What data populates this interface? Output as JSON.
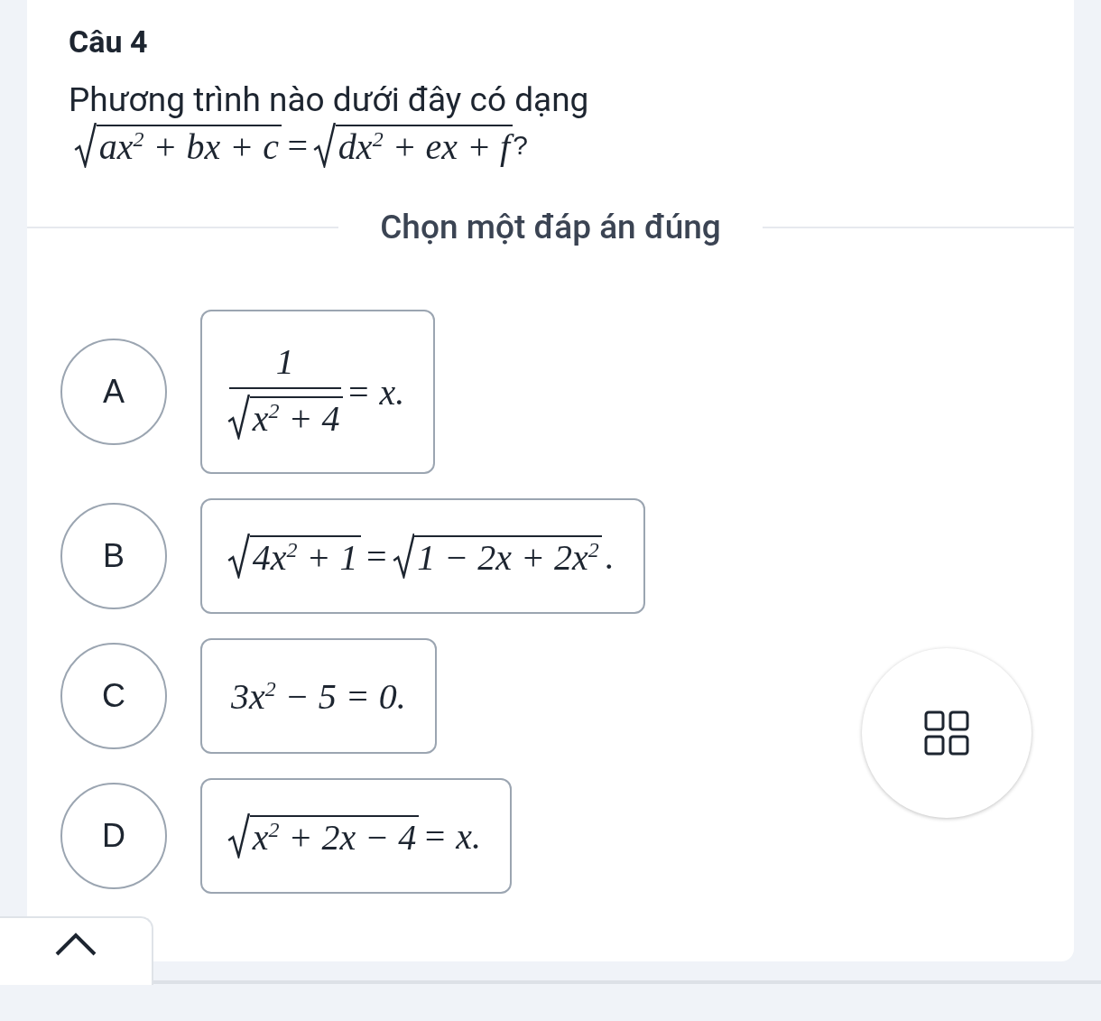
{
  "title": "Câu 4",
  "question": {
    "text": "Phương trình nào dưới đây có dạng",
    "formula": [
      {
        "kind": "sqrt",
        "text": "ax$^{2}$ + bx + c"
      },
      {
        "kind": "text",
        "text": "="
      },
      {
        "kind": "sqrt",
        "text": "dx$^{2}$ + ex + f"
      },
      {
        "kind": "plain",
        "text": "?"
      }
    ]
  },
  "instruction": "Chọn một đáp án đúng",
  "options": [
    {
      "label": "A",
      "selected": false,
      "formula": [
        {
          "kind": "frac",
          "num": [
            {
              "kind": "text",
              "text": "1"
            }
          ],
          "den": [
            {
              "kind": "sqrt",
              "text": "x$^{2}$ + 4"
            }
          ]
        },
        {
          "kind": "text",
          "text": "= x."
        }
      ]
    },
    {
      "label": "B",
      "selected": false,
      "formula": [
        {
          "kind": "sqrt",
          "text": "4x$^{2}$ + 1"
        },
        {
          "kind": "text",
          "text": "="
        },
        {
          "kind": "sqrt",
          "text": "1 − 2x + 2x$^{2}$"
        },
        {
          "kind": "text",
          "text": "."
        }
      ]
    },
    {
      "label": "C",
      "selected": false,
      "formula": [
        {
          "kind": "text",
          "text": "3x$^{2}$ − 5 = 0."
        }
      ]
    },
    {
      "label": "D",
      "selected": false,
      "formula": [
        {
          "kind": "sqrt",
          "text": "x$^{2}$ + 2x − 4"
        },
        {
          "kind": "text",
          "text": "= x."
        }
      ]
    }
  ]
}
